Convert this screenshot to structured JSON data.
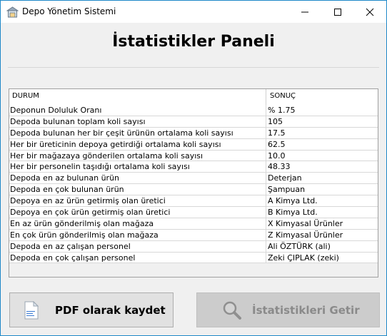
{
  "window": {
    "title": "Depo Yönetim Sistemi"
  },
  "heading": "İstatistikler Paneli",
  "table": {
    "columns": [
      "DURUM",
      "SONUÇ"
    ],
    "rows": [
      [
        "Deponun Doluluk Oranı",
        "% 1.75"
      ],
      [
        "Depoda bulunan toplam koli sayısı",
        "105"
      ],
      [
        "Depoda bulunan her bir çeşit ürünün ortalama koli sayısı",
        "17.5"
      ],
      [
        "Her bir üreticinin depoya getirdiği ortalama koli sayısı",
        "62.5"
      ],
      [
        "Her bir mağazaya gönderilen ortalama koli sayısı",
        "10.0"
      ],
      [
        "Her bir personelin taşıdığı ortalama koli sayısı",
        "48.33"
      ],
      [
        "Depoda en az bulunan ürün",
        "Deterjan"
      ],
      [
        "Depoda en çok bulunan ürün",
        "Şampuan"
      ],
      [
        "Depoya en az ürün getirmiş olan üretici",
        "A Kimya Ltd."
      ],
      [
        "Depoya en çok ürün getirmiş olan üretici",
        "B Kimya Ltd."
      ],
      [
        "En az ürün gönderilmiş olan mağaza",
        "X Kimyasal Ürünler"
      ],
      [
        "En çok ürün gönderilmiş olan mağaza",
        "Z Kimyasal Ürünler"
      ],
      [
        "Depoda en az çalışan personel",
        "Ali ÖZTÜRK (ali)"
      ],
      [
        "Depoda en çok çalışan personel",
        "Zeki ÇIPLAK (zeki)"
      ]
    ]
  },
  "buttons": {
    "pdf_label": "PDF olarak kaydet",
    "pdf_icon": "pdf-file-icon",
    "stats_label": "İstatistikleri Getir",
    "stats_icon": "search-icon",
    "stats_enabled": false
  },
  "colors": {
    "window_border": "#1e88c8",
    "disabled_button": "#cccccc"
  }
}
